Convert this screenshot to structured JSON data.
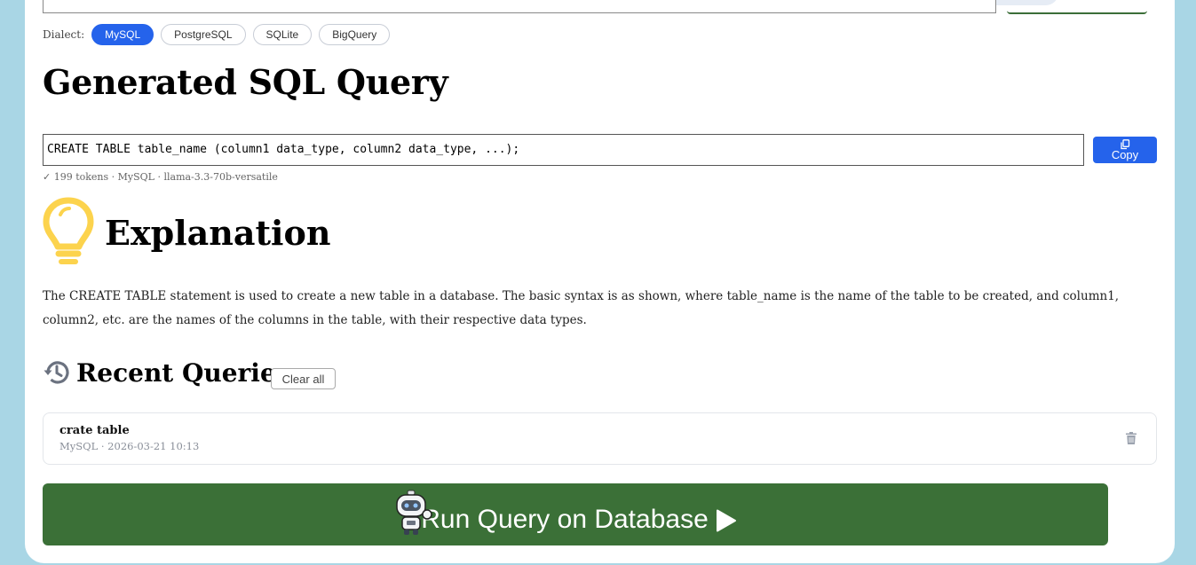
{
  "dialect": {
    "label": "Dialect:",
    "options": [
      "MySQL",
      "PostgreSQL",
      "SQLite",
      "BigQuery"
    ],
    "selected": "MySQL"
  },
  "generated": {
    "heading": "Generated SQL Query",
    "sql": "CREATE TABLE table_name (column1 data_type, column2 data_type, ...);",
    "copy_label": "Copy",
    "meta": "✓ 199 tokens · MySQL · llama-3.3-70b-versatile"
  },
  "explanation": {
    "heading": "Explanation",
    "text": "The CREATE TABLE statement is used to create a new table in a database. The basic syntax is as shown, where table_name is the name of the table to be created, and column1, column2, etc. are the names of the columns in the table, with their respective data types."
  },
  "recent": {
    "heading": "Recent Queries",
    "clear_label": "Clear all",
    "items": [
      {
        "title": "crate table",
        "meta": "MySQL · 2026-03-21 10:13"
      }
    ]
  },
  "run": {
    "label": "Run Query on Database"
  },
  "colors": {
    "accent": "#2563eb",
    "run_button": "#3b7037",
    "background": "#a9d6e5",
    "bulb": "#fcd34d"
  }
}
